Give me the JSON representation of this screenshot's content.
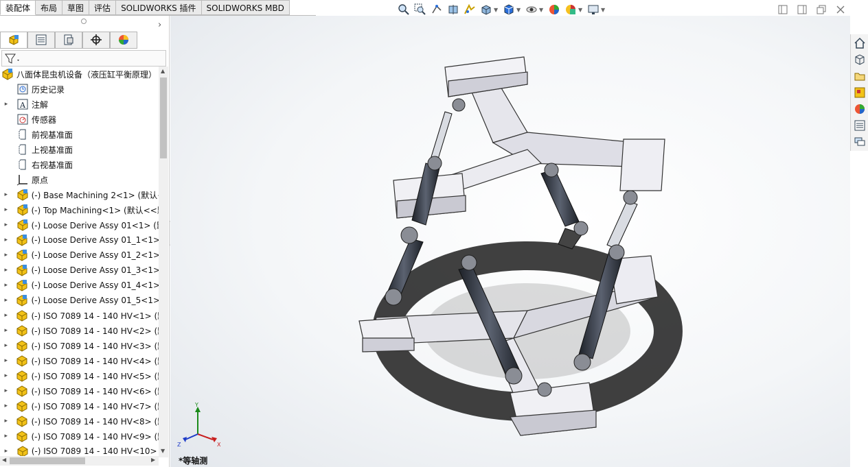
{
  "command_tabs": [
    {
      "label": "装配体",
      "active": true
    },
    {
      "label": "布局",
      "active": false
    },
    {
      "label": "草图",
      "active": false
    },
    {
      "label": "评估",
      "active": false
    },
    {
      "label": "SOLIDWORKS 插件",
      "active": false
    },
    {
      "label": "SOLIDWORKS MBD",
      "active": false
    }
  ],
  "heads_up_toolbar": [
    "zoom-to-fit-icon",
    "zoom-to-area-icon",
    "previous-view-icon",
    "section-view-icon",
    "dynamic-annotation-icon",
    "view-orientation-icon",
    "display-style-icon",
    "hide-show-icon",
    "edit-appearance-icon",
    "apply-scene-icon",
    "view-settings-icon"
  ],
  "tree": {
    "root": "八面体昆虫机设备（液压缸平衡原理）",
    "items": [
      {
        "label": "历史记录",
        "icon": "history",
        "expand": false
      },
      {
        "label": "注解",
        "icon": "annotation",
        "expand": true
      },
      {
        "label": "传感器",
        "icon": "sensor",
        "expand": false
      },
      {
        "label": "前视基准面",
        "icon": "plane",
        "expand": false
      },
      {
        "label": "上视基准面",
        "icon": "plane",
        "expand": false
      },
      {
        "label": "右视基准面",
        "icon": "plane",
        "expand": false
      },
      {
        "label": "原点",
        "icon": "origin",
        "expand": false
      },
      {
        "label": "(-) Base Machining 2<1> (默认<",
        "icon": "assembly",
        "expand": true
      },
      {
        "label": "(-) Top Machining<1> (默认<<默",
        "icon": "assembly",
        "expand": true
      },
      {
        "label": "(-) Loose Derive Assy 01<1> (默",
        "icon": "assembly",
        "expand": true
      },
      {
        "label": "(-) Loose Derive Assy 01_1<1> (",
        "icon": "assembly",
        "expand": true
      },
      {
        "label": "(-) Loose Derive Assy 01_2<1> (",
        "icon": "assembly",
        "expand": true
      },
      {
        "label": "(-) Loose Derive Assy 01_3<1> (",
        "icon": "assembly",
        "expand": true
      },
      {
        "label": "(-) Loose Derive Assy 01_4<1> (",
        "icon": "assembly",
        "expand": true
      },
      {
        "label": "(-) Loose Derive Assy 01_5<1> (",
        "icon": "assembly",
        "expand": true
      },
      {
        "label": "(-) ISO 7089 14 - 140 HV<1> (默",
        "icon": "part",
        "expand": true
      },
      {
        "label": "(-) ISO 7089 14 - 140 HV<2> (默",
        "icon": "part",
        "expand": true
      },
      {
        "label": "(-) ISO 7089 14 - 140 HV<3> (默",
        "icon": "part",
        "expand": true
      },
      {
        "label": "(-) ISO 7089 14 - 140 HV<4> (默",
        "icon": "part",
        "expand": true
      },
      {
        "label": "(-) ISO 7089 14 - 140 HV<5> (默",
        "icon": "part",
        "expand": true
      },
      {
        "label": "(-) ISO 7089 14 - 140 HV<6> (默",
        "icon": "part",
        "expand": true
      },
      {
        "label": "(-) ISO 7089 14 - 140 HV<7> (默",
        "icon": "part",
        "expand": true
      },
      {
        "label": "(-) ISO 7089 14 - 140 HV<8> (默",
        "icon": "part",
        "expand": true
      },
      {
        "label": "(-) ISO 7089 14 - 140 HV<9> (默",
        "icon": "part",
        "expand": true
      },
      {
        "label": "(-) ISO 7089 14 - 140 HV<10> (",
        "icon": "part",
        "expand": true
      }
    ]
  },
  "view_name": "*等轴测",
  "triad": {
    "x": "X",
    "y": "Y",
    "z": "Z"
  },
  "colors": {
    "frame": "#e8e8ee",
    "cylinder": "#3a3f4a",
    "shadow": "#202020",
    "accent_blue": "#2a6fdb"
  }
}
